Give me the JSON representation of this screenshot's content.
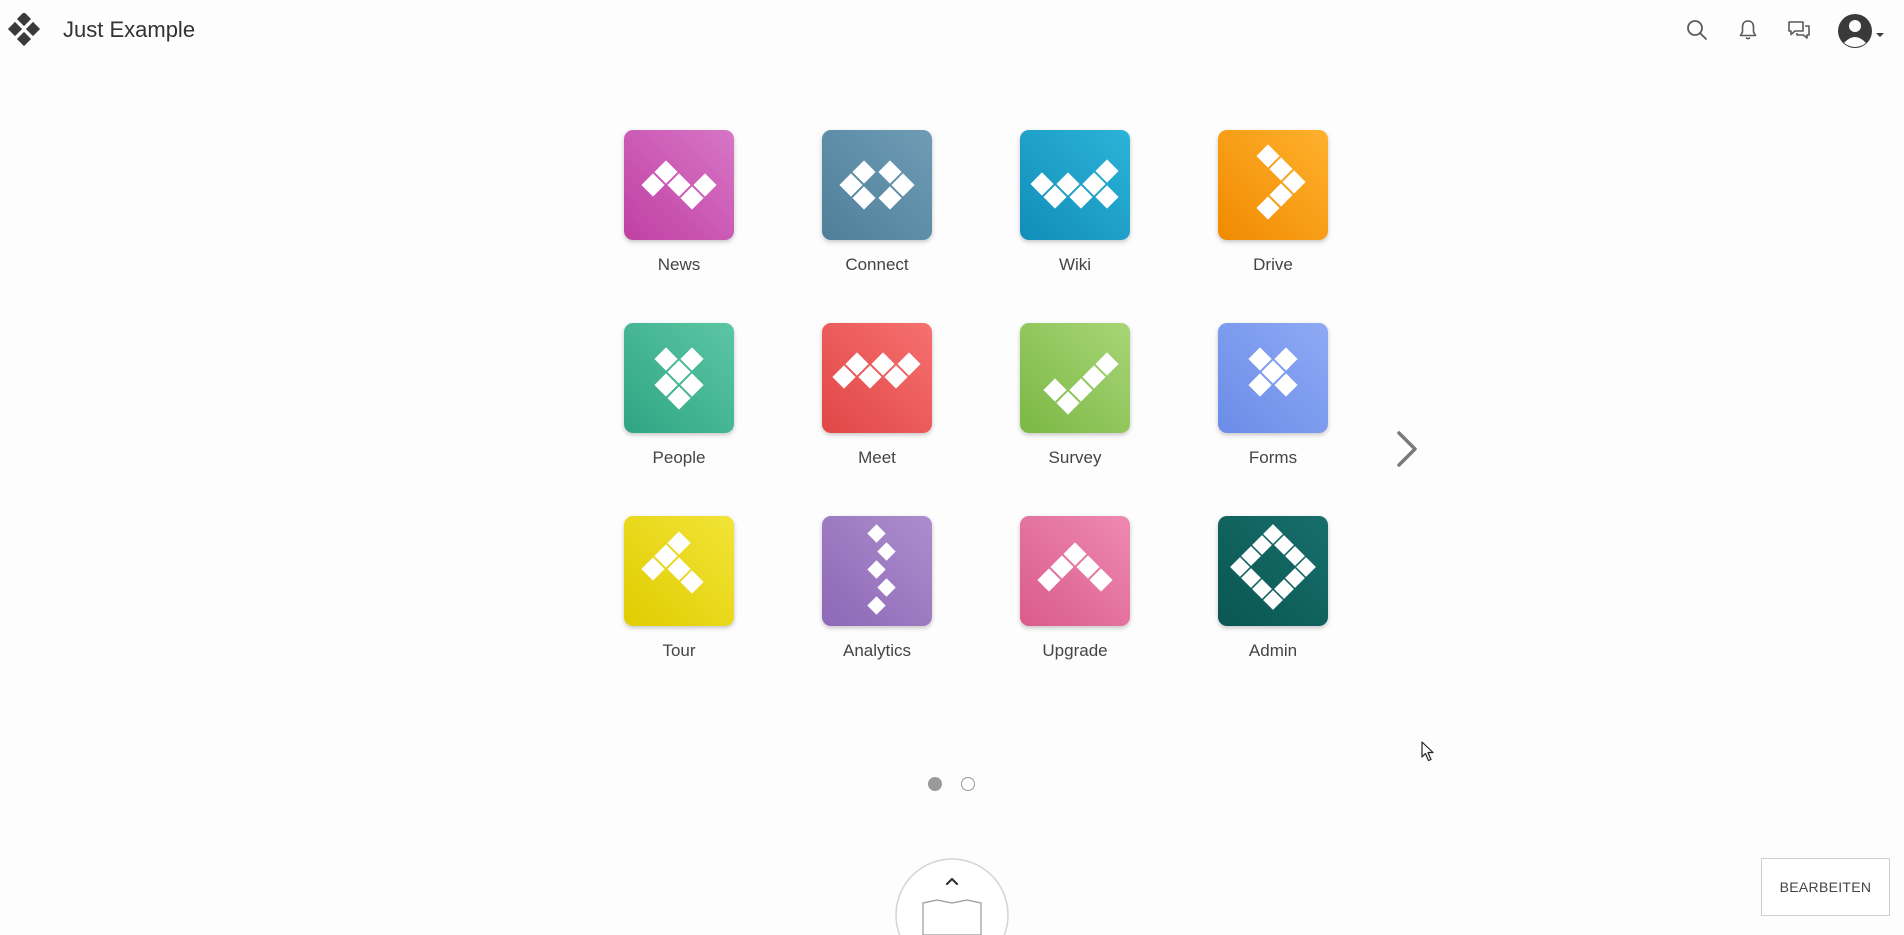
{
  "header": {
    "brand_name": "Just Example",
    "logo_icon": "diamond-logo-icon",
    "icons": [
      "search-icon",
      "bell-icon",
      "chat-icon",
      "user-avatar-icon"
    ]
  },
  "apps": [
    {
      "label": "News",
      "icon": "news-icon",
      "color_from": "#d776c7",
      "color_to": "#c040a2"
    },
    {
      "label": "Connect",
      "icon": "connect-icon",
      "color_from": "#6f9cb5",
      "color_to": "#4e7f9a"
    },
    {
      "label": "Wiki",
      "icon": "wiki-icon",
      "color_from": "#2cb3d8",
      "color_to": "#118eb9"
    },
    {
      "label": "Drive",
      "icon": "drive-icon",
      "color_from": "#ffb12e",
      "color_to": "#f08a00"
    },
    {
      "label": "People",
      "icon": "people-icon",
      "color_from": "#5cc6a4",
      "color_to": "#2fa583"
    },
    {
      "label": "Meet",
      "icon": "meet-icon",
      "color_from": "#f77070",
      "color_to": "#e04646"
    },
    {
      "label": "Survey",
      "icon": "survey-icon",
      "color_from": "#a8d577",
      "color_to": "#7ab843"
    },
    {
      "label": "Forms",
      "icon": "forms-icon",
      "color_from": "#8eaaf5",
      "color_to": "#6b8ce7"
    },
    {
      "label": "Tour",
      "icon": "tour-icon",
      "color_from": "#f2e437",
      "color_to": "#e0cc00"
    },
    {
      "label": "Analytics",
      "icon": "analytics-icon",
      "color_from": "#ad8dcc",
      "color_to": "#8d68b7"
    },
    {
      "label": "Upgrade",
      "icon": "upgrade-icon",
      "color_from": "#ee8ab1",
      "color_to": "#d95b8c"
    },
    {
      "label": "Admin",
      "icon": "admin-icon",
      "color_from": "#176e6b",
      "color_to": "#0a5653"
    }
  ],
  "pager": {
    "current_page": 1,
    "total_pages": 2
  },
  "footer": {
    "edit_label": "BEARBEITEN"
  },
  "colors": {
    "text": "#333333",
    "icon_gray": "#5a5a5a",
    "dot": "#9a9a9a"
  }
}
